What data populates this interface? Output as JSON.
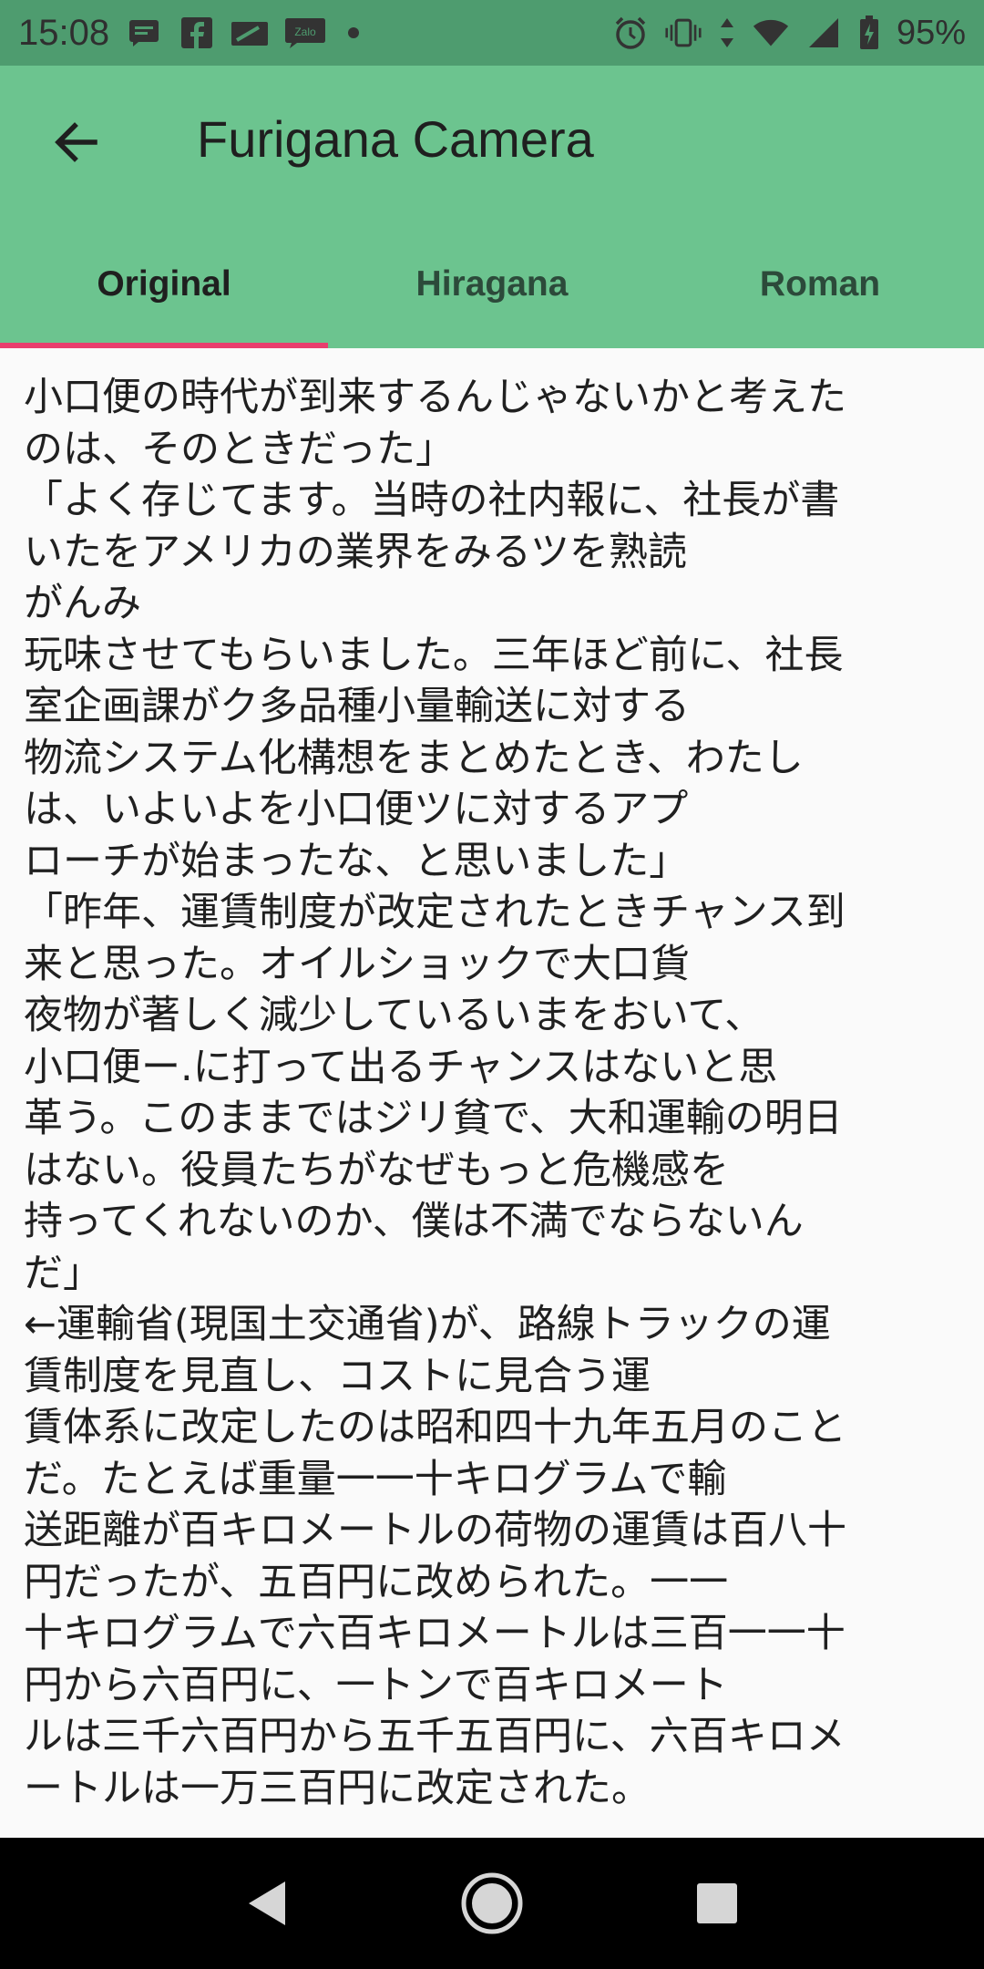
{
  "status_bar": {
    "time": "15:08",
    "notification_icons": [
      "message-icon",
      "facebook-icon",
      "sim-icon",
      "zalo-icon"
    ],
    "zalo_label": "Zalo",
    "system_icons": [
      "alarm-icon",
      "vibrate-icon",
      "data-arrows-icon",
      "wifi-icon",
      "signal-icon",
      "battery-charging-icon"
    ],
    "battery": "95%"
  },
  "app_bar": {
    "title": "Furigana Camera",
    "back_icon": "arrow-back-icon",
    "background": "#6cc48f"
  },
  "tabs": [
    {
      "label": "Original",
      "active": true
    },
    {
      "label": "Hiragana",
      "active": false
    },
    {
      "label": "Roman",
      "active": false
    }
  ],
  "indicator_color": "#e93f6e",
  "content": {
    "lines": [
      "小口便の時代が到来するんじゃないかと考えた",
      "のは、そのときだった」",
      "「よく存じてます。当時の社内報に、社長が書",
      "いたをアメリカの業界をみるツを熟読",
      "がんみ",
      "玩味させてもらいました。三年ほど前に、社長",
      "室企画課がク多品種小量輸送に対する",
      "物流システム化構想をまとめたとき、わたし",
      "は、いよいよを小口便ツに対するアプ",
      "ローチが始まったな、と思いました」",
      "「昨年、運賃制度が改定されたときチャンス到",
      "来と思った。オイルショックで大口貨",
      "夜物が著しく減少しているいまをおいて、",
      "小口便ー.に打って出るチャンスはないと思",
      "革う。このままではジリ貧で、大和運輸の明日",
      "はない。役員たちがなぜもっと危機感を",
      "持ってくれないのか、僕は不満でならないん",
      "だ」",
      "←運輸省(現国土交通省)が、路線トラックの運",
      "賃制度を見直し、コストに見合う運",
      "賃体系に改定したのは昭和四十九年五月のこと",
      "だ。たとえば重量一一十キログラムで輸",
      "送距離が百キロメートルの荷物の運賃は百八十",
      "円だったが、五百円に改められた。一一",
      "十キログラムで六百キロメートルは三百一一十",
      "円から六百円に、一トンで百キロメート",
      "ルは三千六百円から五千五百円に、六百キロメ",
      "ートルは一万三百円に改定された。"
    ]
  },
  "nav_bar": {
    "buttons": [
      "back-triangle-icon",
      "home-circle-icon",
      "recents-square-icon"
    ]
  }
}
